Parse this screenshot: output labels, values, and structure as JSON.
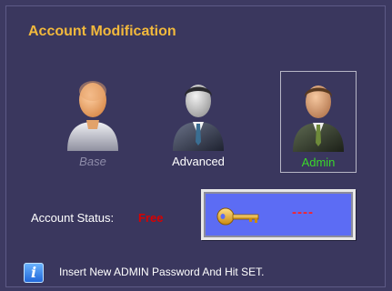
{
  "title": "Account Modification",
  "accounts": [
    {
      "label": "Base",
      "icon": "base-user-icon",
      "state": "disabled"
    },
    {
      "label": "Advanced",
      "icon": "advanced-user-icon",
      "state": "normal"
    },
    {
      "label": "Admin",
      "icon": "admin-user-icon",
      "state": "selected"
    }
  ],
  "status": {
    "label": "Account Status:",
    "value": "Free"
  },
  "password": {
    "value": "----",
    "icon": "key-icon"
  },
  "info": {
    "icon": "info-icon",
    "glyph": "i",
    "text": "Insert New ADMIN Password And Hit SET."
  },
  "colors": {
    "background": "#3d3a62",
    "title": "#f2b93c",
    "status_value": "#d80000",
    "password_field": "#5c6cf4",
    "admin_label": "#3ad82a"
  }
}
